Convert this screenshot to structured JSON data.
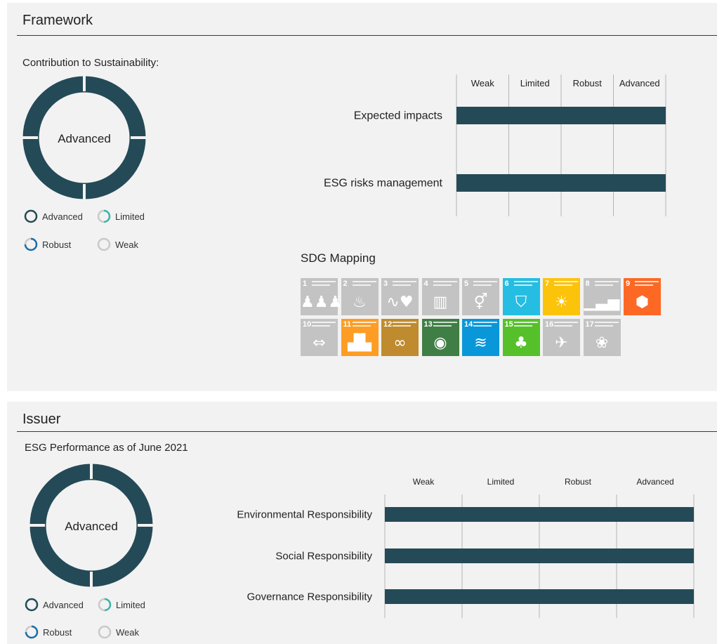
{
  "colors": {
    "bar": "#244a57",
    "donut": "#244a57",
    "limited": "#3bb5a8",
    "robust": "#1b6fa8",
    "weak": "#c9c9c9",
    "sdg_inactive": "#c3c3c3"
  },
  "framework": {
    "title": "Framework",
    "subtitle": "Contribution to Sustainability:",
    "donut_label": "Advanced",
    "legend": [
      "Advanced",
      "Limited",
      "Robust",
      "Weak"
    ],
    "sdg_title": "SDG Mapping"
  },
  "issuer": {
    "title": "Issuer",
    "subtitle": "ESG Performance as of June 2021",
    "donut_label": "Advanced",
    "legend": [
      "Advanced",
      "Limited",
      "Robust",
      "Weak"
    ]
  },
  "chart_data": [
    {
      "type": "bar",
      "orientation": "horizontal",
      "categories": [
        "Expected impacts",
        "ESG risks management"
      ],
      "scale": [
        "Weak",
        "Limited",
        "Robust",
        "Advanced"
      ],
      "values": [
        "Advanced",
        "Advanced"
      ],
      "level_index": [
        4,
        4
      ]
    },
    {
      "type": "bar",
      "orientation": "horizontal",
      "categories": [
        "Environmental Responsibility",
        "Social Responsibility",
        "Governance Responsibility"
      ],
      "scale": [
        "Weak",
        "Limited",
        "Robust",
        "Advanced"
      ],
      "values": [
        "Advanced",
        "Advanced",
        "Advanced"
      ],
      "level_index": [
        4,
        4,
        4
      ]
    }
  ],
  "sdg": [
    {
      "num": "1",
      "active": false,
      "color": "#c3c3c3",
      "icon": "people-icon",
      "glyph": "♟♟♟"
    },
    {
      "num": "2",
      "active": false,
      "color": "#c3c3c3",
      "icon": "bowl-icon",
      "glyph": "♨"
    },
    {
      "num": "3",
      "active": false,
      "color": "#c3c3c3",
      "icon": "heartbeat-icon",
      "glyph": "∿♥"
    },
    {
      "num": "4",
      "active": false,
      "color": "#c3c3c3",
      "icon": "book-icon",
      "glyph": "▥"
    },
    {
      "num": "5",
      "active": false,
      "color": "#c3c3c3",
      "icon": "gender-icon",
      "glyph": "⚥"
    },
    {
      "num": "6",
      "active": true,
      "color": "#26bde2",
      "icon": "water-glass-icon",
      "glyph": "⛉"
    },
    {
      "num": "7",
      "active": true,
      "color": "#fcc30b",
      "icon": "sun-icon",
      "glyph": "☀"
    },
    {
      "num": "8",
      "active": false,
      "color": "#c3c3c3",
      "icon": "growth-chart-icon",
      "glyph": "▁▃▅"
    },
    {
      "num": "9",
      "active": true,
      "color": "#fd6925",
      "icon": "cubes-icon",
      "glyph": "⬢"
    },
    {
      "num": "10",
      "active": false,
      "color": "#c3c3c3",
      "icon": "equality-icon",
      "glyph": "⇔"
    },
    {
      "num": "11",
      "active": true,
      "color": "#fd9d24",
      "icon": "city-icon",
      "glyph": "▟▙"
    },
    {
      "num": "12",
      "active": true,
      "color": "#bf8b2e",
      "icon": "infinity-icon",
      "glyph": "∞"
    },
    {
      "num": "13",
      "active": true,
      "color": "#3f7e44",
      "icon": "eye-globe-icon",
      "glyph": "◉"
    },
    {
      "num": "14",
      "active": true,
      "color": "#0a97d9",
      "icon": "fish-icon",
      "glyph": "≋"
    },
    {
      "num": "15",
      "active": true,
      "color": "#56c02b",
      "icon": "tree-icon",
      "glyph": "♣"
    },
    {
      "num": "16",
      "active": false,
      "color": "#c3c3c3",
      "icon": "dove-icon",
      "glyph": "✈"
    },
    {
      "num": "17",
      "active": false,
      "color": "#c3c3c3",
      "icon": "partnership-icon",
      "glyph": "❀"
    }
  ]
}
